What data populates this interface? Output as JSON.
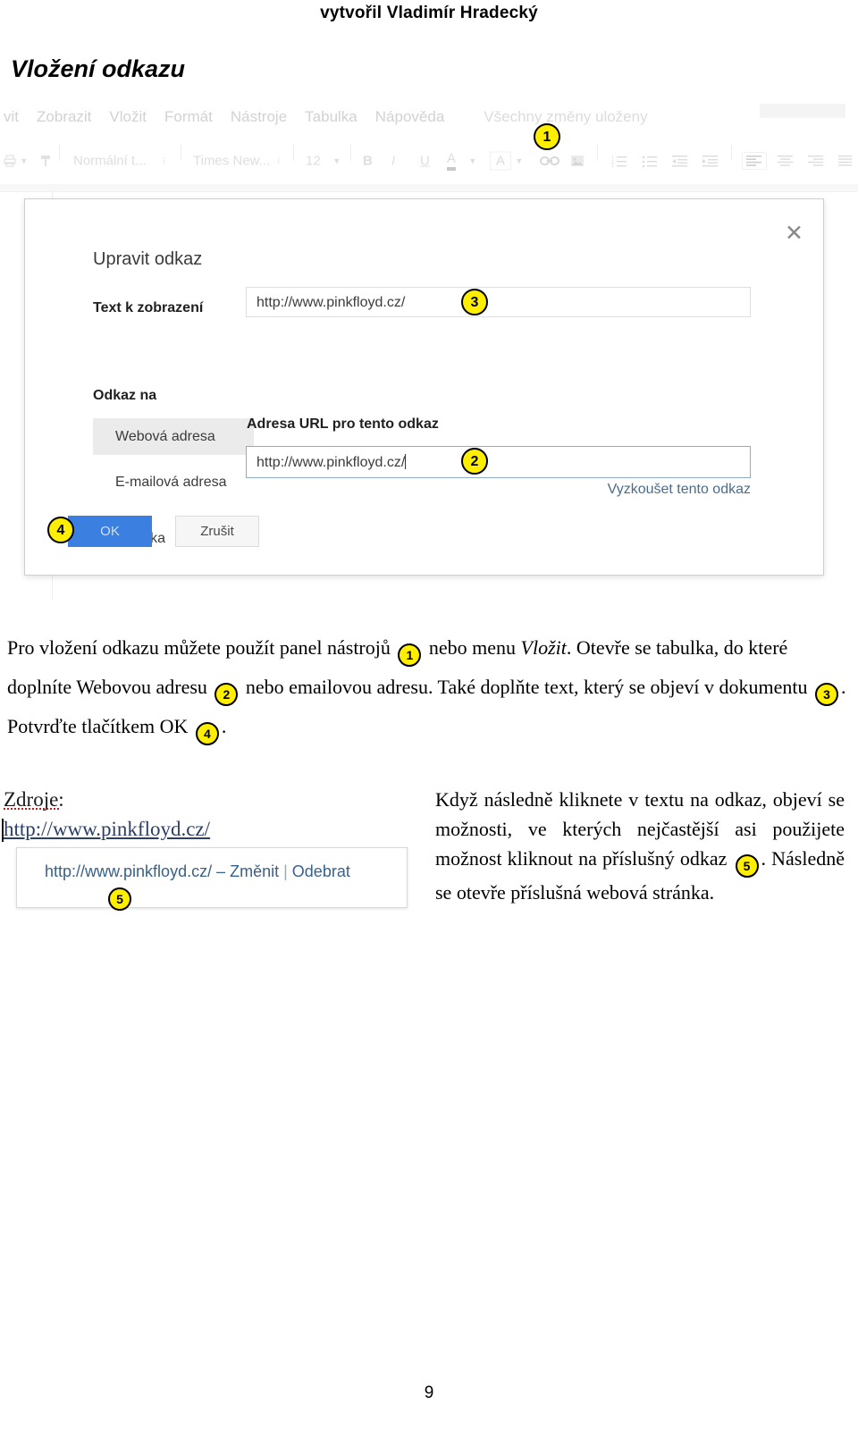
{
  "header": {
    "author_line": "vytvořil Vladimír Hradecký"
  },
  "section": {
    "title": "Vložení odkazu"
  },
  "screenshot": {
    "menubar": {
      "items": [
        "vit",
        "Zobrazit",
        "Vložit",
        "Formát",
        "Nástroje",
        "Tabulka",
        "Nápověda"
      ],
      "save_status": "Všechny změny uloženy"
    },
    "toolbar": {
      "style_select": "Normální t...",
      "font_select": "Times New...",
      "size_select": "12",
      "bold_label": "B",
      "italic_label": "I",
      "underline_label": "U",
      "text_color_label": "A",
      "highlight_label": "A",
      "link_icon": "link-icon",
      "image_icon": "image-icon",
      "numbered_list_icon": "numbered-list-icon",
      "bulleted_list_icon": "bulleted-list-icon",
      "indent_less_icon": "indent-decrease-icon",
      "indent_more_icon": "indent-increase-icon",
      "align_left_icon": "align-left-icon",
      "align_center_icon": "align-center-icon",
      "align_right_icon": "align-right-icon",
      "align_justify_icon": "align-justify-icon"
    },
    "dialog": {
      "title": "Upravit odkaz",
      "close_glyph": "✕",
      "display_text_label": "Text k zobrazení",
      "display_text_value": "http://www.pinkfloyd.cz/",
      "link_to_label": "Odkaz na",
      "link_to_options": [
        "Webová adresa",
        "E-mailová adresa",
        "Záložka"
      ],
      "link_to_selected": "Webová adresa",
      "url_caption": "Adresa URL pro tento odkaz",
      "url_value": "http://www.pinkfloyd.cz/",
      "test_link_label": "Vyzkoušet tento odkaz",
      "ok_label": "OK",
      "cancel_label": "Zrušit"
    }
  },
  "markers": {
    "m1": "1",
    "m2": "2",
    "m3": "3",
    "m4": "4",
    "m5": "5"
  },
  "body": {
    "p1_a": "Pro vložení odkazu můžete použít panel nástrojů ",
    "p1_b": " nebo menu ",
    "p1_b_em": "Vložit",
    "p1_c": ". Otevře se tabulka, do které doplníte Webovou adresu ",
    "p1_d": " nebo emailovou adresu. Také doplňte text, který se objeví v dokumentu ",
    "p1_e": ". Potvrďte tlačítkem OK ",
    "p1_f": ".",
    "p2_a": "Když následně kliknete v textu na odkaz, objeví se možnosti, ve kterých nejčastější asi použijete možnost kliknout na příslušný odkaz ",
    "p2_b": ". Následně se otevře příslušná webová stránka."
  },
  "figure": {
    "zdroje_label": "Zdroje:",
    "link_text": "http://www.pinkfloyd.cz/",
    "popup_url": "http://www.pinkfloyd.cz/ – ",
    "popup_change": "Změnit",
    "popup_sep": " | ",
    "popup_remove": "Odebrat"
  },
  "footer": {
    "page_number": "9"
  },
  "colors": {
    "marker_fill": "#ffee00",
    "ok_button": "#3b7fe0",
    "link_blue": "#39618c",
    "url_focus_border": "#90aec3"
  }
}
